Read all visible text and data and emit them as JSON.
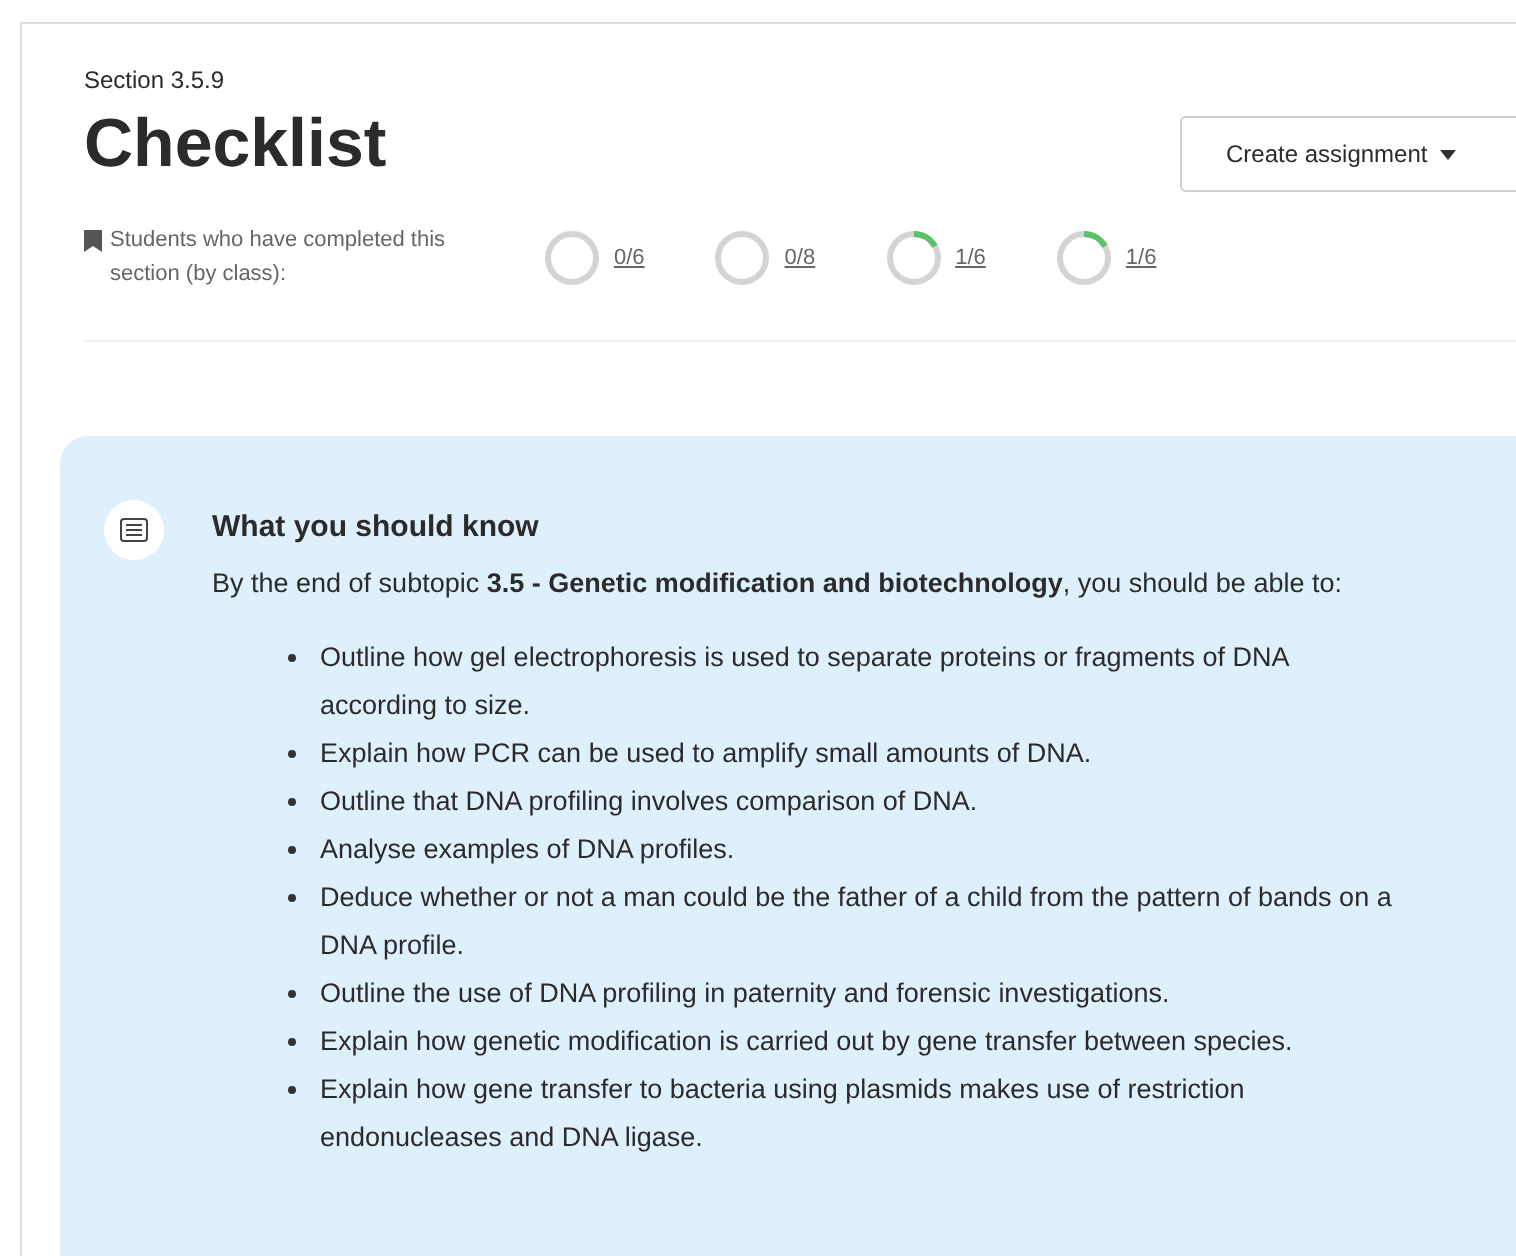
{
  "section_label": "Section 3.5.9",
  "title": "Checklist",
  "create_button": {
    "label": "Create assignment"
  },
  "completion": {
    "label": "Students who have completed this section (by class):",
    "classes": [
      {
        "count": "0/6",
        "started": false
      },
      {
        "count": "0/8",
        "started": false
      },
      {
        "count": "1/6",
        "started": true
      },
      {
        "count": "1/6",
        "started": true
      }
    ]
  },
  "card": {
    "heading": "What you should know",
    "intro": "By the end of subtopic **3.5 - Genetic modification and biotechnology**, you should be able to:",
    "items": [
      "Outline how gel electrophoresis is used to separate proteins or fragments of DNA according to size.",
      "Explain how PCR can be used to amplify small amounts of DNA.",
      "Outline that DNA profiling involves comparison of DNA.",
      "Analyse examples of DNA profiles.",
      "Deduce whether or not a man could be the father of a child from the pattern of bands on a DNA profile.",
      "Outline the use of DNA profiling in paternity and forensic investigations.",
      "Explain how genetic modification is carried out by gene transfer between species.",
      "Explain how gene transfer to bacteria using plasmids makes use of restriction endonucleases and DNA ligase."
    ]
  }
}
